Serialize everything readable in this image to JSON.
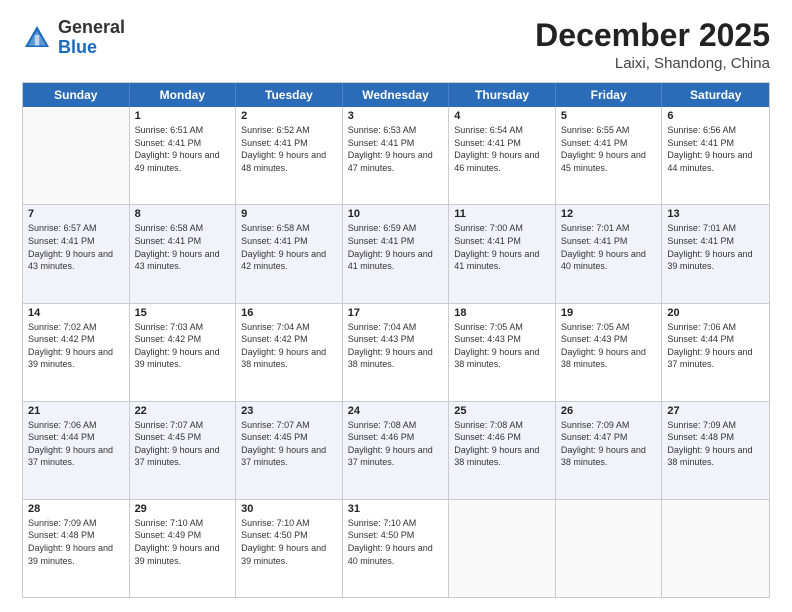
{
  "header": {
    "logo": {
      "general": "General",
      "blue": "Blue"
    },
    "title": "December 2025",
    "location": "Laixi, Shandong, China"
  },
  "calendar": {
    "days_of_week": [
      "Sunday",
      "Monday",
      "Tuesday",
      "Wednesday",
      "Thursday",
      "Friday",
      "Saturday"
    ],
    "weeks": [
      [
        {
          "day": "",
          "empty": true
        },
        {
          "day": "1",
          "sunrise": "Sunrise: 6:51 AM",
          "sunset": "Sunset: 4:41 PM",
          "daylight": "Daylight: 9 hours and 49 minutes."
        },
        {
          "day": "2",
          "sunrise": "Sunrise: 6:52 AM",
          "sunset": "Sunset: 4:41 PM",
          "daylight": "Daylight: 9 hours and 48 minutes."
        },
        {
          "day": "3",
          "sunrise": "Sunrise: 6:53 AM",
          "sunset": "Sunset: 4:41 PM",
          "daylight": "Daylight: 9 hours and 47 minutes."
        },
        {
          "day": "4",
          "sunrise": "Sunrise: 6:54 AM",
          "sunset": "Sunset: 4:41 PM",
          "daylight": "Daylight: 9 hours and 46 minutes."
        },
        {
          "day": "5",
          "sunrise": "Sunrise: 6:55 AM",
          "sunset": "Sunset: 4:41 PM",
          "daylight": "Daylight: 9 hours and 45 minutes."
        },
        {
          "day": "6",
          "sunrise": "Sunrise: 6:56 AM",
          "sunset": "Sunset: 4:41 PM",
          "daylight": "Daylight: 9 hours and 44 minutes."
        }
      ],
      [
        {
          "day": "7",
          "sunrise": "Sunrise: 6:57 AM",
          "sunset": "Sunset: 4:41 PM",
          "daylight": "Daylight: 9 hours and 43 minutes."
        },
        {
          "day": "8",
          "sunrise": "Sunrise: 6:58 AM",
          "sunset": "Sunset: 4:41 PM",
          "daylight": "Daylight: 9 hours and 43 minutes."
        },
        {
          "day": "9",
          "sunrise": "Sunrise: 6:58 AM",
          "sunset": "Sunset: 4:41 PM",
          "daylight": "Daylight: 9 hours and 42 minutes."
        },
        {
          "day": "10",
          "sunrise": "Sunrise: 6:59 AM",
          "sunset": "Sunset: 4:41 PM",
          "daylight": "Daylight: 9 hours and 41 minutes."
        },
        {
          "day": "11",
          "sunrise": "Sunrise: 7:00 AM",
          "sunset": "Sunset: 4:41 PM",
          "daylight": "Daylight: 9 hours and 41 minutes."
        },
        {
          "day": "12",
          "sunrise": "Sunrise: 7:01 AM",
          "sunset": "Sunset: 4:41 PM",
          "daylight": "Daylight: 9 hours and 40 minutes."
        },
        {
          "day": "13",
          "sunrise": "Sunrise: 7:01 AM",
          "sunset": "Sunset: 4:41 PM",
          "daylight": "Daylight: 9 hours and 39 minutes."
        }
      ],
      [
        {
          "day": "14",
          "sunrise": "Sunrise: 7:02 AM",
          "sunset": "Sunset: 4:42 PM",
          "daylight": "Daylight: 9 hours and 39 minutes."
        },
        {
          "day": "15",
          "sunrise": "Sunrise: 7:03 AM",
          "sunset": "Sunset: 4:42 PM",
          "daylight": "Daylight: 9 hours and 39 minutes."
        },
        {
          "day": "16",
          "sunrise": "Sunrise: 7:04 AM",
          "sunset": "Sunset: 4:42 PM",
          "daylight": "Daylight: 9 hours and 38 minutes."
        },
        {
          "day": "17",
          "sunrise": "Sunrise: 7:04 AM",
          "sunset": "Sunset: 4:43 PM",
          "daylight": "Daylight: 9 hours and 38 minutes."
        },
        {
          "day": "18",
          "sunrise": "Sunrise: 7:05 AM",
          "sunset": "Sunset: 4:43 PM",
          "daylight": "Daylight: 9 hours and 38 minutes."
        },
        {
          "day": "19",
          "sunrise": "Sunrise: 7:05 AM",
          "sunset": "Sunset: 4:43 PM",
          "daylight": "Daylight: 9 hours and 38 minutes."
        },
        {
          "day": "20",
          "sunrise": "Sunrise: 7:06 AM",
          "sunset": "Sunset: 4:44 PM",
          "daylight": "Daylight: 9 hours and 37 minutes."
        }
      ],
      [
        {
          "day": "21",
          "sunrise": "Sunrise: 7:06 AM",
          "sunset": "Sunset: 4:44 PM",
          "daylight": "Daylight: 9 hours and 37 minutes."
        },
        {
          "day": "22",
          "sunrise": "Sunrise: 7:07 AM",
          "sunset": "Sunset: 4:45 PM",
          "daylight": "Daylight: 9 hours and 37 minutes."
        },
        {
          "day": "23",
          "sunrise": "Sunrise: 7:07 AM",
          "sunset": "Sunset: 4:45 PM",
          "daylight": "Daylight: 9 hours and 37 minutes."
        },
        {
          "day": "24",
          "sunrise": "Sunrise: 7:08 AM",
          "sunset": "Sunset: 4:46 PM",
          "daylight": "Daylight: 9 hours and 37 minutes."
        },
        {
          "day": "25",
          "sunrise": "Sunrise: 7:08 AM",
          "sunset": "Sunset: 4:46 PM",
          "daylight": "Daylight: 9 hours and 38 minutes."
        },
        {
          "day": "26",
          "sunrise": "Sunrise: 7:09 AM",
          "sunset": "Sunset: 4:47 PM",
          "daylight": "Daylight: 9 hours and 38 minutes."
        },
        {
          "day": "27",
          "sunrise": "Sunrise: 7:09 AM",
          "sunset": "Sunset: 4:48 PM",
          "daylight": "Daylight: 9 hours and 38 minutes."
        }
      ],
      [
        {
          "day": "28",
          "sunrise": "Sunrise: 7:09 AM",
          "sunset": "Sunset: 4:48 PM",
          "daylight": "Daylight: 9 hours and 39 minutes."
        },
        {
          "day": "29",
          "sunrise": "Sunrise: 7:10 AM",
          "sunset": "Sunset: 4:49 PM",
          "daylight": "Daylight: 9 hours and 39 minutes."
        },
        {
          "day": "30",
          "sunrise": "Sunrise: 7:10 AM",
          "sunset": "Sunset: 4:50 PM",
          "daylight": "Daylight: 9 hours and 39 minutes."
        },
        {
          "day": "31",
          "sunrise": "Sunrise: 7:10 AM",
          "sunset": "Sunset: 4:50 PM",
          "daylight": "Daylight: 9 hours and 40 minutes."
        },
        {
          "day": "",
          "empty": true
        },
        {
          "day": "",
          "empty": true
        },
        {
          "day": "",
          "empty": true
        }
      ]
    ]
  }
}
